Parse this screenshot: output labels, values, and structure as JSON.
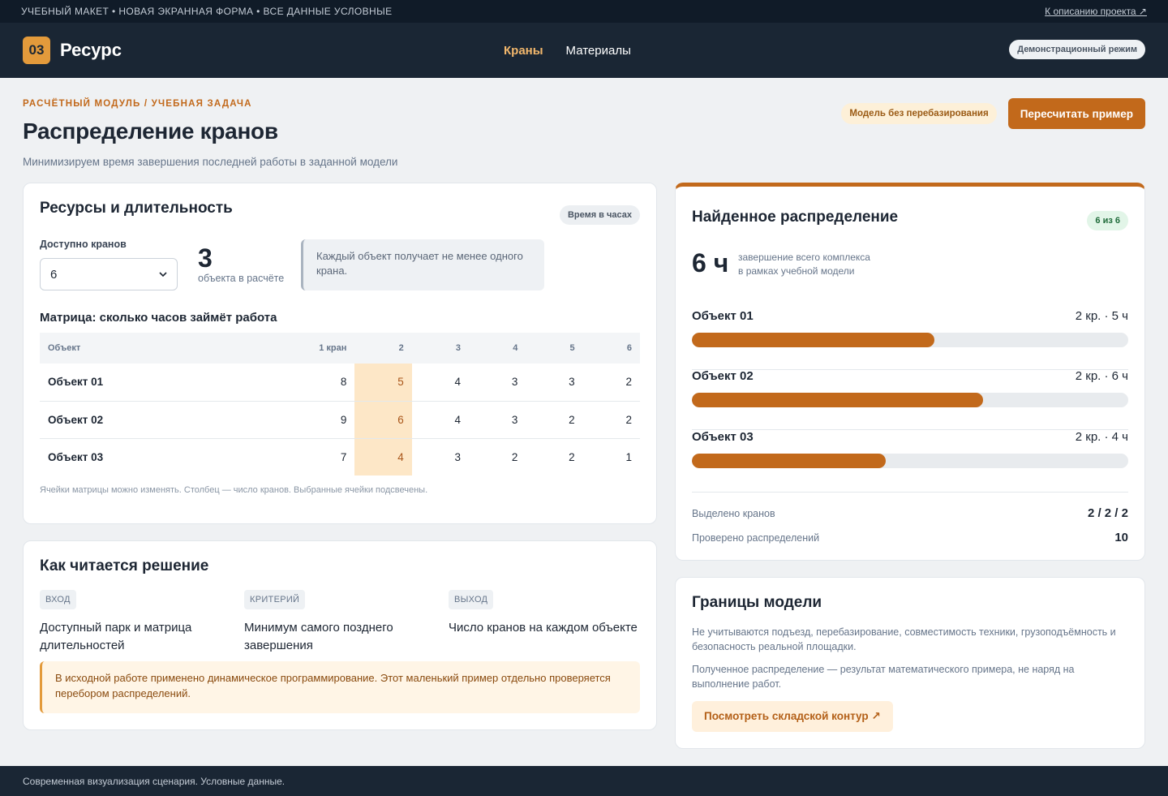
{
  "topstrip": {
    "text": "УЧЕБНЫЙ МАКЕТ • НОВАЯ ЭКРАННАЯ ФОРМА • ВСЕ ДАННЫЕ УСЛОВНЫЕ",
    "link": "К описанию проекта ↗"
  },
  "header": {
    "logo_badge": "03",
    "logo_text": "Ресурс",
    "nav": [
      "Краны",
      "Материалы"
    ],
    "demo": "Демонстрационный режим"
  },
  "page": {
    "eyebrow": "РАСЧЁТНЫЙ МОДУЛЬ / УЧЕБНАЯ ЗАДАЧА",
    "title": "Распределение кранов",
    "subtitle": "Минимизируем время завершения последней работы в заданной модели",
    "badge": "Модель без перебазирования",
    "recalc_button": "Пересчитать пример"
  },
  "resources": {
    "title": "Ресурсы и длительность",
    "tag": "Время в часах",
    "cranes_label": "Доступно кранов",
    "cranes_value": "6",
    "objects_count": "3",
    "objects_label": "объекта в расчёте",
    "note": "Каждый объект получает не менее одного крана.",
    "matrix_title": "Матрица: сколько часов займёт работа",
    "matrix_headers": [
      "Объект",
      "1 кран",
      "2",
      "3",
      "4",
      "5",
      "6"
    ],
    "matrix_rows": [
      [
        "Объект 01",
        "8",
        "5",
        "4",
        "3",
        "3",
        "2"
      ],
      [
        "Объект 02",
        "9",
        "6",
        "4",
        "3",
        "2",
        "2"
      ],
      [
        "Объект 03",
        "7",
        "4",
        "3",
        "2",
        "2",
        "1"
      ]
    ],
    "matrix_highlight_col": 2,
    "footnote": "Ячейки матрицы можно изменять. Столбец — число кранов. Выбранные ячейки подсвечены."
  },
  "how": {
    "title": "Как читается решение",
    "columns": [
      {
        "tag": "ВХОД",
        "text": "Доступный парк и матрица длительностей"
      },
      {
        "tag": "КРИТЕРИЙ",
        "text": "Минимум самого позднего завершения"
      },
      {
        "tag": "ВЫХОД",
        "text": "Число кранов на каждом объекте"
      }
    ],
    "note": "В исходной работе применено динамическое программирование. Этот маленький пример отдельно проверяется перебором распределений."
  },
  "result": {
    "title": "Найденное распределение",
    "tag": "6 из 6",
    "makespan": "6 ч",
    "makespan_caption_1": "завершение всего комплекса",
    "makespan_caption_2": "в рамках учебной модели",
    "objects": [
      {
        "name": "Объект 01",
        "meta": "2 кр. · 5 ч",
        "fraction": 0.5556
      },
      {
        "name": "Объект 02",
        "meta": "2 кр. · 6 ч",
        "fraction": 0.6667
      },
      {
        "name": "Объект 03",
        "meta": "2 кр. · 4 ч",
        "fraction": 0.4444
      }
    ],
    "allocated_label": "Выделено кранов",
    "allocated_value": "2 / 2 / 2",
    "checked_label": "Проверено распределений",
    "checked_value": "10"
  },
  "bounds": {
    "title": "Границы модели",
    "p1": "Не учитываются подъезд, перебазирование, совместимость техники, грузоподъёмность и безопасность реальной площадки.",
    "p2": "Полученное распределение — результат математического примера, не наряд на выполнение работ.",
    "button": "Посмотреть складской контур ↗"
  },
  "footer": {
    "text": "Современная визуализация сценария. Условные данные."
  },
  "colors": {
    "accent": "#c2691b",
    "header_bg": "#1a2634",
    "highlight_cell": "#fde7c7"
  }
}
